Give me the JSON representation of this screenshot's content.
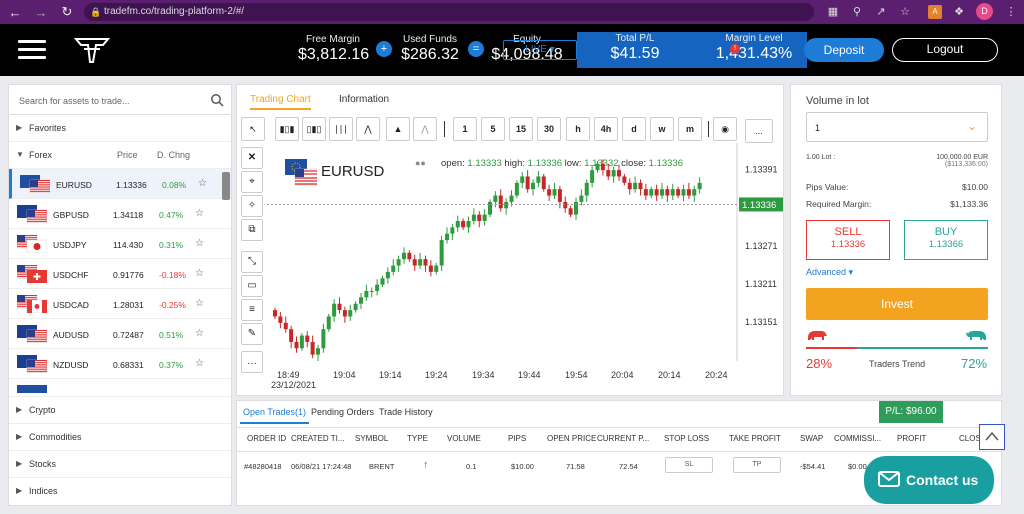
{
  "browser": {
    "url": "tradefm.co/trading-platform-2/#/",
    "avatar": "D"
  },
  "topbar": {
    "free_margin_label": "Free Margin",
    "free_margin_value": "$3,812.16",
    "plus_symbol": "+",
    "used_funds_label": "Used Funds",
    "used_funds_value": "$286.32",
    "equals_symbol": "=",
    "equity_label": "Equity",
    "equity_value": "$4,098.48",
    "live_label": "LIVE",
    "total_pl_label": "Total P/L",
    "total_pl_value": "$41.59",
    "margin_level_label": "Margin Level",
    "margin_level_value": "1,431.43%",
    "margin_badge": "!",
    "deposit_label": "Deposit",
    "logout_label": "Logout"
  },
  "left_panel": {
    "search_placeholder": "Search for assets to trade...",
    "favorites_label": "Favorites",
    "forex_label": "Forex",
    "price_header": "Price",
    "change_header": "D. Chng",
    "assets": [
      {
        "symbol": "EURUSD",
        "price": "1.13336",
        "change": "0.08%",
        "dir": "up"
      },
      {
        "symbol": "GBPUSD",
        "price": "1.34118",
        "change": "0.47%",
        "dir": "up"
      },
      {
        "symbol": "USDJPY",
        "price": "114.430",
        "change": "0.31%",
        "dir": "up"
      },
      {
        "symbol": "USDCHF",
        "price": "0.91776",
        "change": "-0.18%",
        "dir": "down"
      },
      {
        "symbol": "USDCAD",
        "price": "1.28031",
        "change": "-0.25%",
        "dir": "down"
      },
      {
        "symbol": "AUDUSD",
        "price": "0.72487",
        "change": "0.51%",
        "dir": "up"
      },
      {
        "symbol": "NZDUSD",
        "price": "0.68331",
        "change": "0.37%",
        "dir": "up"
      }
    ],
    "categories": [
      "Crypto",
      "Commodities",
      "Stocks",
      "Indices"
    ]
  },
  "chart_panel": {
    "tab_chart": "Trading Chart",
    "tab_info": "Information",
    "timeframes": [
      "1",
      "5",
      "15",
      "30",
      "h",
      "4h",
      "d",
      "w",
      "m"
    ],
    "more_label": "...",
    "symbol": "EURUSD",
    "ohlc": {
      "open_label": "open:",
      "open": "1.13333",
      "high_label": "high:",
      "high": "1.13336",
      "low_label": "low:",
      "low": "1.13332",
      "close_label": "close:",
      "close": "1.13336"
    },
    "current_price": "1.13336"
  },
  "chart_data": {
    "type": "candlestick",
    "symbol": "EURUSD",
    "x_tick_labels": [
      "18:49",
      "19:04",
      "19:14",
      "19:24",
      "19:34",
      "19:44",
      "19:54",
      "20:04",
      "20:14",
      "20:24"
    ],
    "x_date_label": "23/12/2021",
    "y_tick_labels": [
      "1.13391",
      "1.13271",
      "1.13211",
      "1.13151"
    ],
    "ylim": [
      1.1309,
      1.1342
    ],
    "last_price": 1.13336,
    "closes": [
      1.1316,
      1.1315,
      1.1314,
      1.1312,
      1.1311,
      1.1313,
      1.1312,
      1.131,
      1.1311,
      1.1314,
      1.1316,
      1.1318,
      1.1317,
      1.1316,
      1.1317,
      1.1318,
      1.1319,
      1.132,
      1.132,
      1.1321,
      1.1322,
      1.1323,
      1.1324,
      1.1325,
      1.1326,
      1.1325,
      1.1324,
      1.1325,
      1.1324,
      1.1323,
      1.1324,
      1.1328,
      1.1329,
      1.133,
      1.1331,
      1.133,
      1.1331,
      1.1332,
      1.1331,
      1.1332,
      1.1334,
      1.1335,
      1.1333,
      1.1334,
      1.1335,
      1.1337,
      1.1338,
      1.1336,
      1.1337,
      1.1338,
      1.1336,
      1.1335,
      1.1336,
      1.1334,
      1.1333,
      1.1332,
      1.1334,
      1.1335,
      1.1337,
      1.1339,
      1.134,
      1.1339,
      1.1338,
      1.1339,
      1.1338,
      1.1337,
      1.1336,
      1.1337,
      1.1336,
      1.1335,
      1.1336,
      1.1335,
      1.1336,
      1.1335,
      1.1336,
      1.1335,
      1.1336,
      1.1335,
      1.1336,
      1.1337
    ]
  },
  "right_panel": {
    "volume_label": "Volume in lot",
    "volume_value": "1",
    "lot_label": "1.00 Lot :",
    "lot_value": "100,000.00 EUR",
    "lot_value_usd": "($113,336.00)",
    "pip_label": "Pips Value:",
    "pip_value": "$10.00",
    "margin_label": "Required Margin:",
    "margin_value": "$1,133.36",
    "sell_label": "SELL",
    "sell_price": "1.13336",
    "buy_label": "BUY",
    "buy_price": "1.13366",
    "advanced_label": "Advanced",
    "invest_label": "Invest",
    "bear_pct": "28%",
    "bull_pct": "72%",
    "bear_fraction": 0.28,
    "trend_label": "Traders Trend"
  },
  "bottom_panel": {
    "tabs": [
      "Open Trades(1)",
      "Pending Orders",
      "Trade History"
    ],
    "pl_tag": "P/L: $96.00",
    "headers": [
      "ORDER ID",
      "CREATED TI...",
      "SYMBOL",
      "TYPE",
      "VOLUME",
      "PIPS",
      "OPEN PRICE",
      "CURRENT P...",
      "STOP LOSS",
      "TAKE PROFIT",
      "SWAP",
      "COMMISSI...",
      "PROFIT",
      "CLOSE"
    ],
    "row": {
      "order_id": "#48280418",
      "created": "06/08/21 17:24:48",
      "symbol": "BRENT",
      "volume": "0.1",
      "pips": "$10.00",
      "open_price": "71.58",
      "current_price": "72.54",
      "stop_loss": "SL",
      "take_profit": "TP",
      "swap": "-$54.41",
      "commission": "$0.00"
    }
  },
  "contact_label": "Contact us",
  "colors": {
    "accent": "#1e7bd6",
    "orange": "#f4a320",
    "green": "#2e9c3e",
    "red": "#e53935",
    "teal": "#1a9fa0"
  }
}
